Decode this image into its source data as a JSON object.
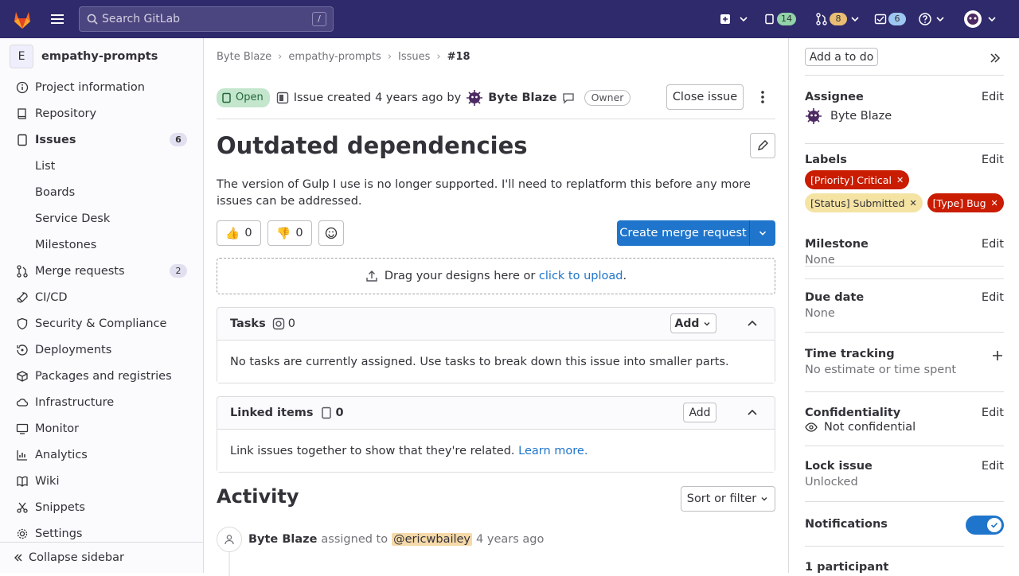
{
  "topbar": {
    "search_placeholder": "Search GitLab",
    "search_shortcut": "/",
    "issues_count": "14",
    "mr_count": "8",
    "todo_count": "6"
  },
  "sidebar": {
    "project_initial": "E",
    "project_name": "empathy-prompts",
    "items": [
      {
        "label": "Project information",
        "icon": "info-icon"
      },
      {
        "label": "Repository",
        "icon": "repository-icon"
      },
      {
        "label": "Issues",
        "icon": "issues-icon",
        "badge": "6"
      },
      {
        "label": "List"
      },
      {
        "label": "Boards"
      },
      {
        "label": "Service Desk"
      },
      {
        "label": "Milestones"
      },
      {
        "label": "Merge requests",
        "icon": "merge-request-icon",
        "badge": "2"
      },
      {
        "label": "CI/CD",
        "icon": "rocket-icon"
      },
      {
        "label": "Security & Compliance",
        "icon": "shield-icon"
      },
      {
        "label": "Deployments",
        "icon": "deployments-icon"
      },
      {
        "label": "Packages and registries",
        "icon": "package-icon"
      },
      {
        "label": "Infrastructure",
        "icon": "cloud-icon"
      },
      {
        "label": "Monitor",
        "icon": "monitor-icon"
      },
      {
        "label": "Analytics",
        "icon": "chart-icon"
      },
      {
        "label": "Wiki",
        "icon": "book-icon"
      },
      {
        "label": "Snippets",
        "icon": "snippet-icon"
      },
      {
        "label": "Settings",
        "icon": "gear-icon"
      }
    ],
    "collapse_label": "Collapse sidebar"
  },
  "breadcrumb": [
    "Byte Blaze",
    "empathy-prompts",
    "Issues",
    "#18"
  ],
  "issue": {
    "status": "Open",
    "created_text": "Issue created",
    "created_time": "4 years ago",
    "by": "by",
    "author": "Byte Blaze",
    "role_badge": "Owner",
    "close_label": "Close issue",
    "title": "Outdated dependencies",
    "description": "The version of Gulp I use is no longer supported. I'll need to replatform this before any more issues can be addressed.",
    "thumbs_up": "0",
    "thumbs_down": "0",
    "create_mr_label": "Create merge request",
    "upload_text": "Drag your designs here or",
    "upload_link": "click to upload",
    "upload_end": "."
  },
  "tasks": {
    "title": "Tasks",
    "count": "0",
    "add_label": "Add",
    "empty_text": "No tasks are currently assigned. Use tasks to break down this issue into smaller parts."
  },
  "linked": {
    "title": "Linked items",
    "count": "0",
    "add_label": "Add",
    "body_text": "Link issues together to show that they're related.",
    "learn_more": "Learn more."
  },
  "activity": {
    "title": "Activity",
    "sort_label": "Sort or filter",
    "entry_author": "Byte Blaze",
    "entry_action": "assigned to",
    "entry_mention": "@ericwbailey",
    "entry_time": "4 years ago"
  },
  "right": {
    "todo_label": "Add a to do",
    "assignee_title": "Assignee",
    "assignee_name": "Byte Blaze",
    "edit": "Edit",
    "labels_title": "Labels",
    "labels": [
      {
        "text": "[Priority] Critical",
        "bg": "#c91c00",
        "fg": "#ffffff"
      },
      {
        "text": "[Status] Submitted",
        "bg": "#f5e3a4",
        "fg": "#333238"
      },
      {
        "text": "[Type] Bug",
        "bg": "#c91c00",
        "fg": "#ffffff"
      }
    ],
    "milestone_title": "Milestone",
    "milestone_value": "None",
    "due_title": "Due date",
    "due_value": "None",
    "time_title": "Time tracking",
    "time_value": "No estimate or time spent",
    "conf_title": "Confidentiality",
    "conf_value": "Not confidential",
    "lock_title": "Lock issue",
    "lock_value": "Unlocked",
    "notif_title": "Notifications",
    "participants": "1 participant"
  },
  "colors": {
    "topbar": "#2f2a6b",
    "accent": "#1f75cb",
    "open_green": "#24663b"
  }
}
